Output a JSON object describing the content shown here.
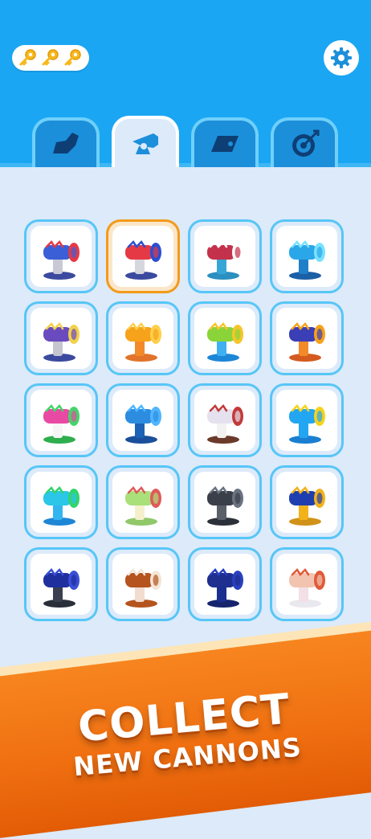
{
  "header": {
    "keys": [
      "key-icon",
      "key-icon",
      "key-icon"
    ],
    "settings_icon": "gear-icon"
  },
  "tabs": [
    {
      "name": "tab-boot",
      "icon": "boot-icon",
      "active": false
    },
    {
      "name": "tab-cannon",
      "icon": "cannon-icon",
      "active": true
    },
    {
      "name": "tab-ramp",
      "icon": "ramp-icon",
      "active": false
    },
    {
      "name": "tab-target",
      "icon": "target-icon",
      "active": false
    }
  ],
  "cannons": [
    {
      "body": "#3b5fd6",
      "accent": "#e63946",
      "stand": "#c9c9d6",
      "base": "#3b4a9e",
      "selected": false
    },
    {
      "body": "#e63946",
      "accent": "#2a4fd1",
      "stand": "#d6d6de",
      "base": "#3b4a9e",
      "selected": true
    },
    {
      "body": "#c4314b",
      "accent": "#ffffff",
      "stand": "#37a6d6",
      "base": "#2b8fc0",
      "selected": false
    },
    {
      "body": "#2aa7e8",
      "accent": "#79e1ff",
      "stand": "#1f7fc9",
      "base": "#1b5fa6",
      "selected": false
    },
    {
      "body": "#6a4bbf",
      "accent": "#f2d24a",
      "stand": "#c6c6d0",
      "base": "#3b4a9e",
      "selected": false
    },
    {
      "body": "#f7a21b",
      "accent": "#ffcf4a",
      "stand": "#f28a2a",
      "base": "#e2732a",
      "selected": false
    },
    {
      "body": "#8ad43a",
      "accent": "#f7c52a",
      "stand": "#3fb0f2",
      "base": "#1e86d6",
      "selected": false
    },
    {
      "body": "#3b3fb5",
      "accent": "#f7a21b",
      "stand": "#f28a2a",
      "base": "#d45b1f",
      "selected": false
    },
    {
      "body": "#e84aa3",
      "accent": "#44d46a",
      "stand": "#f6f6f6",
      "base": "#2fae4e",
      "selected": false
    },
    {
      "body": "#2c8de0",
      "accent": "#4fb6ff",
      "stand": "#1c62b5",
      "base": "#1a4f9a",
      "selected": false
    },
    {
      "body": "#e6e1ee",
      "accent": "#c23a3a",
      "stand": "#f2f2f2",
      "base": "#6b3a2a",
      "selected": false
    },
    {
      "body": "#22a6f2",
      "accent": "#f7d21b",
      "stand": "#22a6f2",
      "base": "#1a7fd0",
      "selected": false
    },
    {
      "body": "#2bc6e8",
      "accent": "#33d46a",
      "stand": "#33b6f0",
      "base": "#1f86d6",
      "selected": false
    },
    {
      "body": "#a9e07a",
      "accent": "#e05a5a",
      "stand": "#f4f0cc",
      "base": "#90c86a",
      "selected": false
    },
    {
      "body": "#3a3f4a",
      "accent": "#6b7280",
      "stand": "#5a5f6a",
      "base": "#2c3038",
      "selected": false
    },
    {
      "body": "#1f3fb0",
      "accent": "#f2b21b",
      "stand": "#f2b21b",
      "base": "#d1921a",
      "selected": false
    },
    {
      "body": "#1f2f9e",
      "accent": "#3a4fd6",
      "stand": "#3a4050",
      "base": "#2a2f3a",
      "selected": false
    },
    {
      "body": "#b5541f",
      "accent": "#f2e6d6",
      "stand": "#f2dccf",
      "base": "#b5541f",
      "selected": false
    },
    {
      "body": "#1f2f8f",
      "accent": "#2a3fbf",
      "stand": "#1a2f8f",
      "base": "#16246e",
      "selected": false
    },
    {
      "body": "#f2c4b0",
      "accent": "#e05a3a",
      "stand": "#f2e0e6",
      "base": "#e8e8ee",
      "selected": false
    }
  ],
  "banner": {
    "line1": "COLLECT",
    "line2": "NEW CANNONS"
  }
}
